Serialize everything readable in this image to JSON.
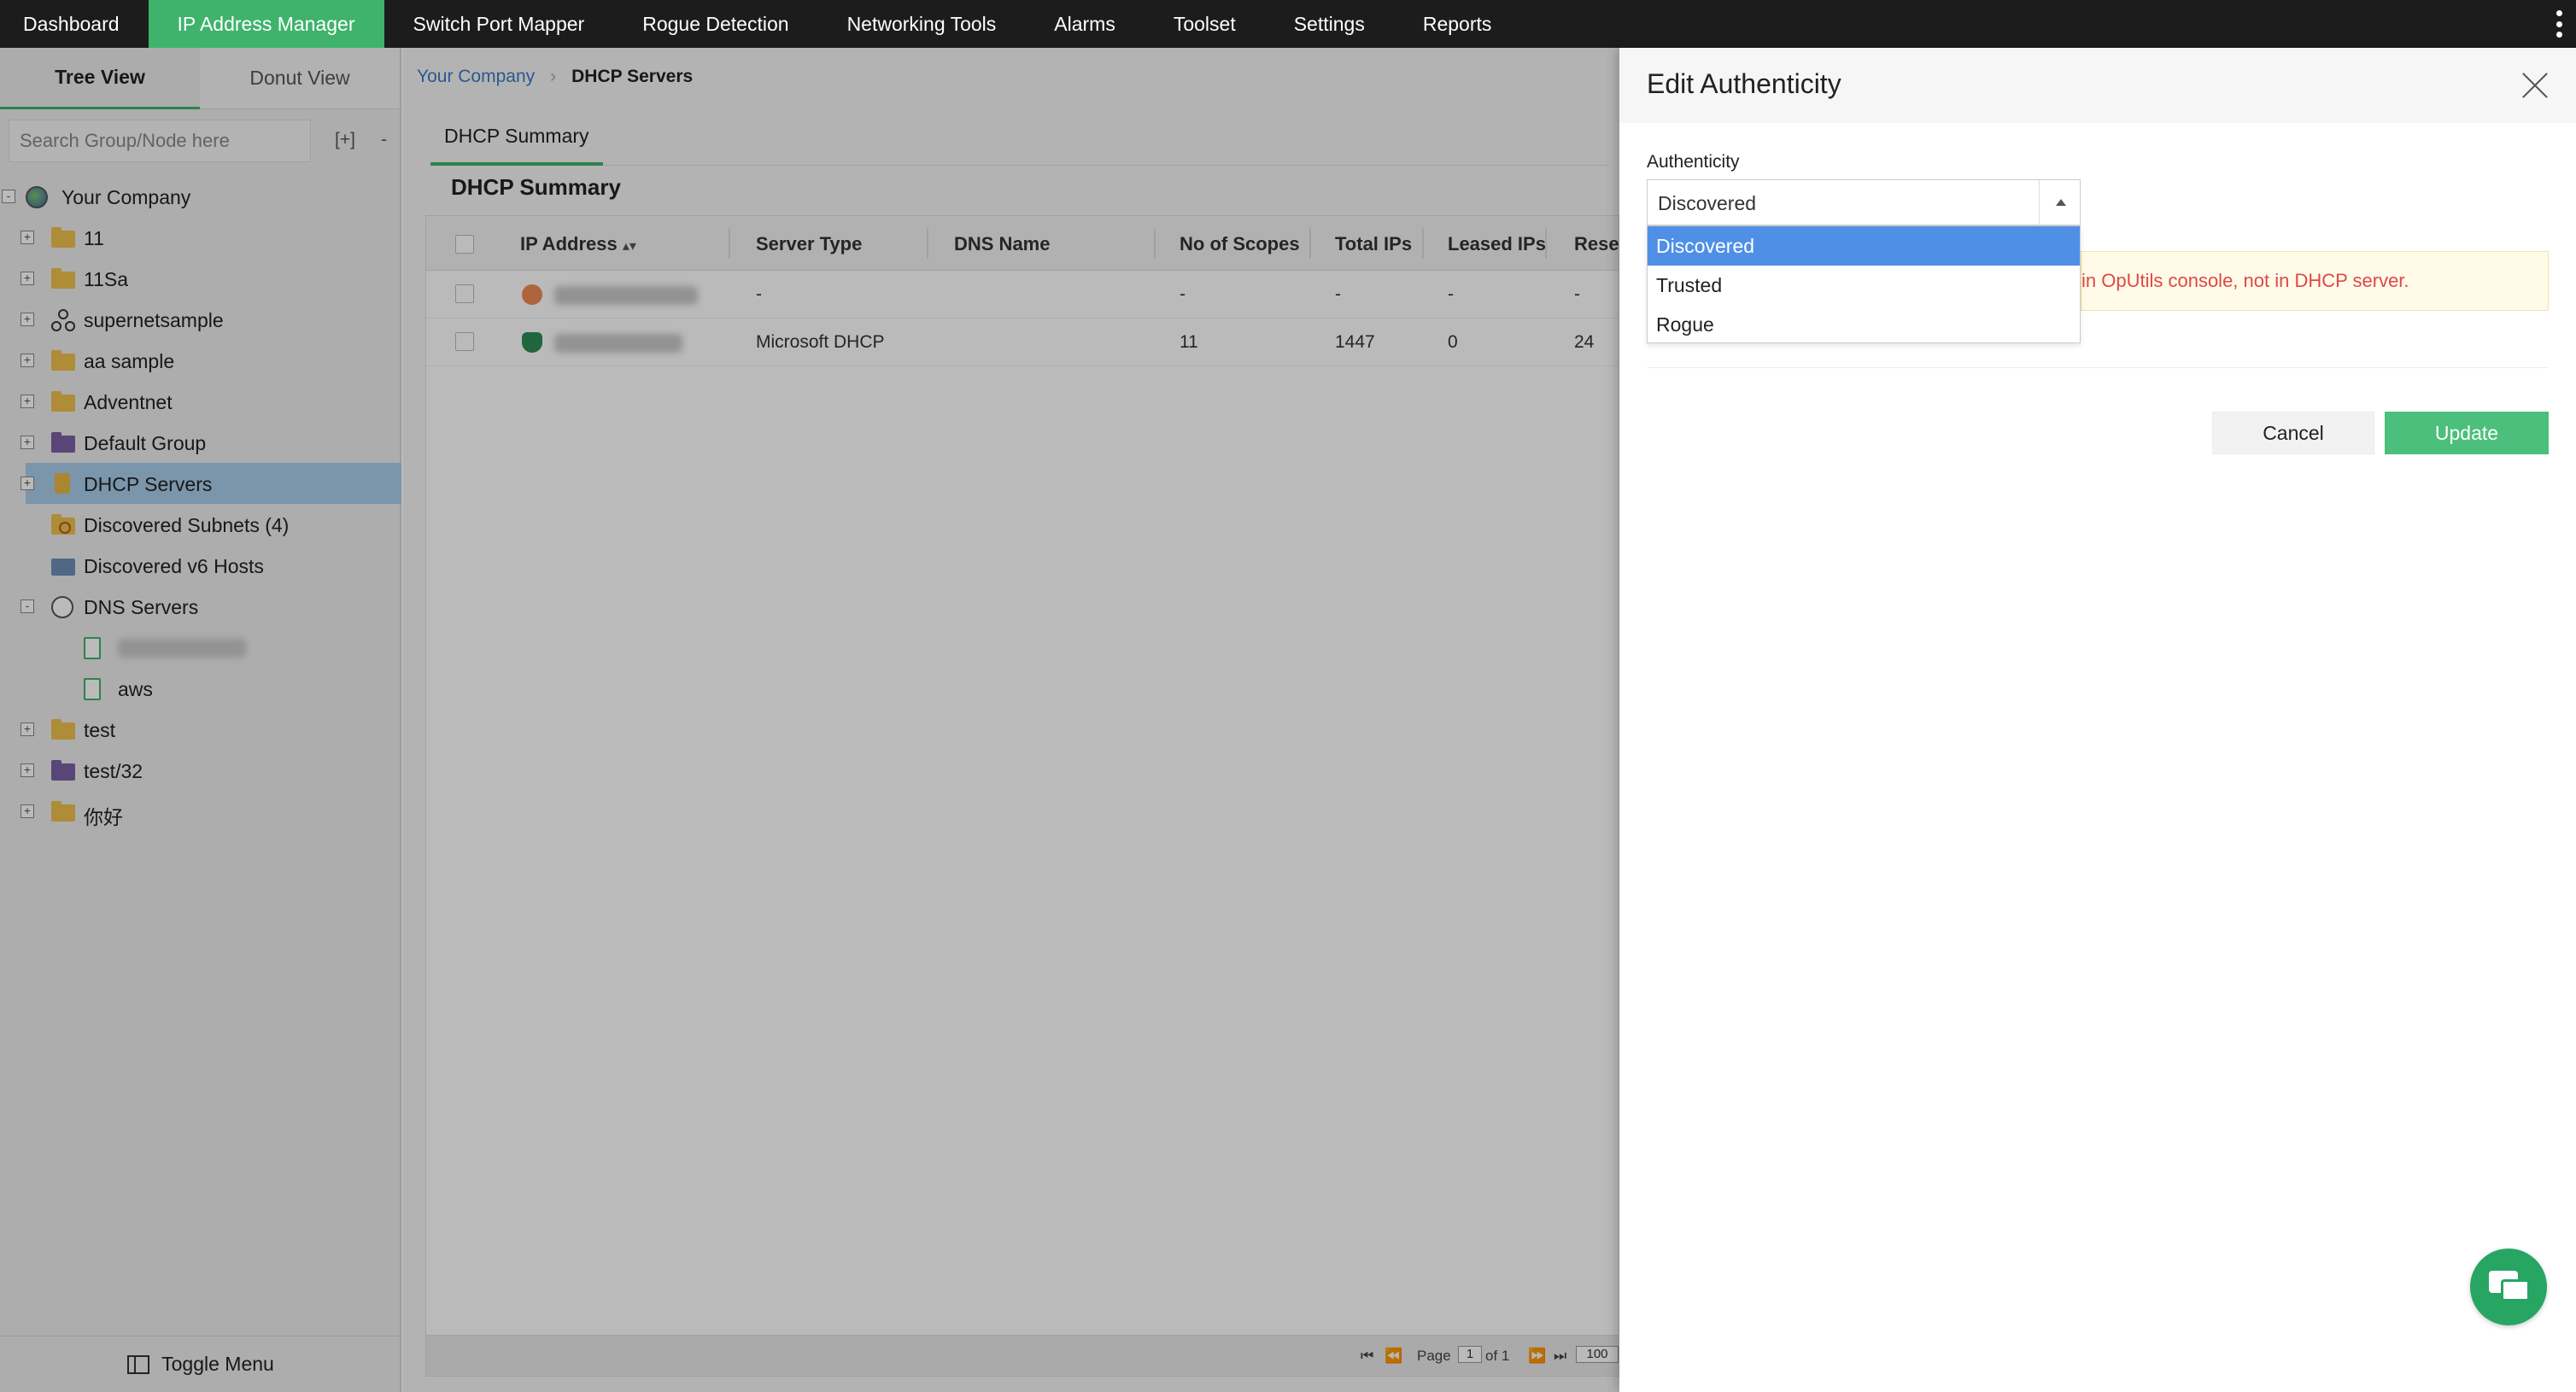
{
  "nav": {
    "items": [
      "Dashboard",
      "IP Address Manager",
      "Switch Port Mapper",
      "Rogue Detection",
      "Networking Tools",
      "Alarms",
      "Toolset",
      "Settings",
      "Reports"
    ],
    "active": "IP Address Manager",
    "accent_color": "#3fb36c"
  },
  "left": {
    "tabs": [
      "Tree View",
      "Donut View"
    ],
    "search_placeholder": "Search Group/Node here",
    "expand_all": "[+]",
    "collapse_all": "-",
    "tree": [
      {
        "label": "Your Company",
        "toggle": "-",
        "icon": "globe-icon",
        "indent": 0
      },
      {
        "label": "11",
        "toggle": "+",
        "icon": "folder-icon",
        "indent": 1
      },
      {
        "label": "11Sa",
        "toggle": "+",
        "icon": "folder-icon",
        "indent": 1
      },
      {
        "label": "supernetsample",
        "toggle": "+",
        "icon": "network-icon",
        "indent": 1
      },
      {
        "label": "aa sample",
        "toggle": "+",
        "icon": "folder-icon",
        "indent": 1
      },
      {
        "label": "Adventnet",
        "toggle": "+",
        "icon": "folder-icon",
        "indent": 1
      },
      {
        "label": "Default Group",
        "toggle": "+",
        "icon": "folder-purple-icon",
        "indent": 1
      },
      {
        "label": "DHCP Servers",
        "toggle": "+",
        "icon": "dhcp-server-icon",
        "indent": 1,
        "selected": true
      },
      {
        "label": "Discovered Subnets (4)",
        "toggle": "",
        "icon": "discovered-subnets-icon",
        "indent": 1
      },
      {
        "label": "Discovered v6 Hosts",
        "toggle": "",
        "icon": "discovered-hosts-icon",
        "indent": 1
      },
      {
        "label": "DNS Servers",
        "toggle": "-",
        "icon": "dns-globe-icon",
        "indent": 1
      },
      {
        "label": "",
        "toggle": "",
        "icon": "dns-zone-icon",
        "indent": 2,
        "blurred": true
      },
      {
        "label": "aws",
        "toggle": "",
        "icon": "dns-zone-icon",
        "indent": 2
      },
      {
        "label": "test",
        "toggle": "+",
        "icon": "folder-icon",
        "indent": 1
      },
      {
        "label": "test/32",
        "toggle": "+",
        "icon": "folder-purple-icon",
        "indent": 1
      },
      {
        "label": "你好",
        "toggle": "+",
        "icon": "folder-icon",
        "indent": 1
      }
    ],
    "toggle_menu": "Toggle Menu"
  },
  "main": {
    "breadcrumb": {
      "root": "Your Company",
      "current": "DHCP Servers"
    },
    "tab": "DHCP Summary",
    "title": "DHCP Summary",
    "columns": [
      "IP Address",
      "Server Type",
      "DNS Name",
      "No of Scopes",
      "Total IPs",
      "Leased IPs",
      "Reser"
    ],
    "rows": [
      {
        "status": "rogue",
        "ip": "",
        "server_type": "-",
        "dns": "",
        "scopes": "-",
        "total": "-",
        "leased": "-",
        "reserved": "-"
      },
      {
        "status": "trusted",
        "ip": "",
        "server_type": "Microsoft DHCP",
        "dns": "",
        "scopes": "11",
        "total": "1447",
        "leased": "0",
        "reserved": "24"
      }
    ],
    "pager": {
      "page_label": "Page",
      "page": "1",
      "of": "of 1",
      "per_page": "100"
    }
  },
  "drawer": {
    "title": "Edit Authenticity",
    "field_label": "Authenticity",
    "selected": "Discovered",
    "options": [
      "Discovered",
      "Trusted",
      "Rogue"
    ],
    "warning": "in OpUtils console, not in DHCP server.",
    "cancel": "Cancel",
    "update": "Update",
    "update_color": "#4bbf7b",
    "highlight_color": "#4f90e6"
  }
}
